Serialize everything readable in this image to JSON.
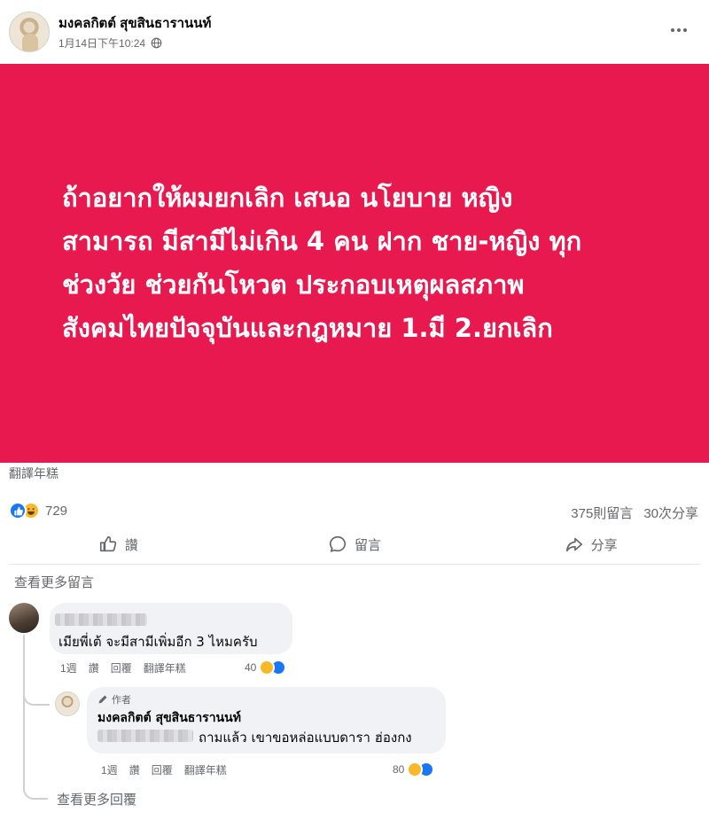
{
  "post": {
    "author": "มงคลกิตต์ สุขสินธารานนท์",
    "timestamp": "1月14日下午10:24",
    "image_text_lines": [
      "ถ้าอยากให้ผมยกเลิก เสนอ นโยบาย หญิง",
      "สามารถ มีสามีไม่เกิน 4 คน ฝาก ชาย-หญิง ทุก",
      "ช่วงวัย ช่วยกันโหวต ประกอบเหตุผลสภาพ",
      "สังคมไทยปัจจุบันและกฎหมาย 1.มี 2.ยกเลิก"
    ],
    "image_bg_color": "#e8194e",
    "translate_label": "翻譯年糕"
  },
  "stats": {
    "reaction_count": "729",
    "comments": "375則留言",
    "shares": "30次分享"
  },
  "actions": {
    "like": "讚",
    "comment": "留言",
    "share": "分享"
  },
  "comments": {
    "view_more": "查看更多留言",
    "items": [
      {
        "text": "เมียพี่เต้ จะมีสามีเพิ่มอีก 3 ไหมครับ",
        "time": "1週",
        "like": "讚",
        "reply": "回覆",
        "translate": "翻譯年糕",
        "reactions": "40"
      }
    ],
    "reply": {
      "badge": "作者",
      "author": "มงคลกิตต์ สุขสินธารานนท์",
      "text": "ถามแล้ว เขาขอหล่อแบบดารา ฮ่องกง",
      "time": "1週",
      "like": "讚",
      "reply": "回覆",
      "translate": "翻譯年糕",
      "reactions": "80"
    },
    "view_more_replies": "查看更多回覆"
  }
}
